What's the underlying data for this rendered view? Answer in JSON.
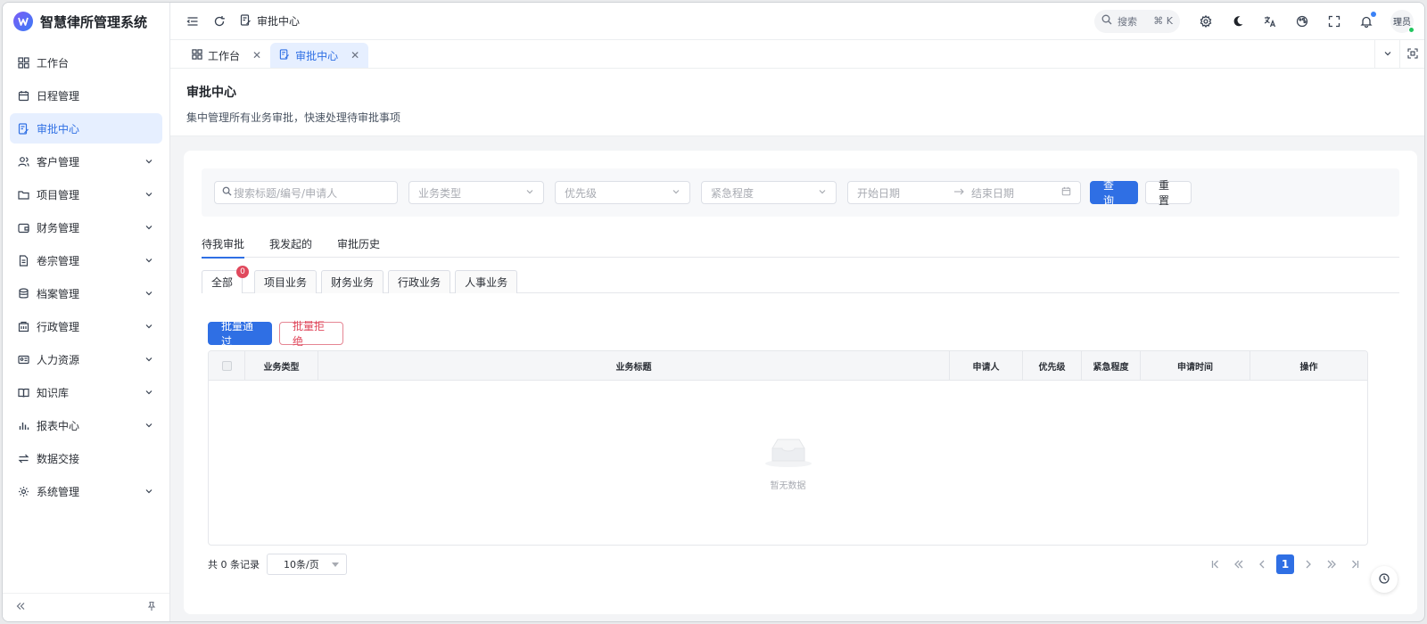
{
  "app": {
    "title": "智慧律所管理系统"
  },
  "sidebar": {
    "items": [
      {
        "label": "工作台",
        "icon": "dashboard-icon",
        "expandable": false
      },
      {
        "label": "日程管理",
        "icon": "calendar-icon",
        "expandable": false
      },
      {
        "label": "审批中心",
        "icon": "approval-icon",
        "expandable": false,
        "active": true
      },
      {
        "label": "客户管理",
        "icon": "users-icon",
        "expandable": true
      },
      {
        "label": "项目管理",
        "icon": "folder-icon",
        "expandable": true
      },
      {
        "label": "财务管理",
        "icon": "wallet-icon",
        "expandable": true
      },
      {
        "label": "卷宗管理",
        "icon": "file-icon",
        "expandable": true
      },
      {
        "label": "档案管理",
        "icon": "database-icon",
        "expandable": true
      },
      {
        "label": "行政管理",
        "icon": "building-icon",
        "expandable": true
      },
      {
        "label": "人力资源",
        "icon": "id-card-icon",
        "expandable": true
      },
      {
        "label": "知识库",
        "icon": "book-icon",
        "expandable": true
      },
      {
        "label": "报表中心",
        "icon": "bar-chart-icon",
        "expandable": true
      },
      {
        "label": "数据交接",
        "icon": "swap-icon",
        "expandable": false
      },
      {
        "label": "系统管理",
        "icon": "gear-icon",
        "expandable": true
      }
    ]
  },
  "header": {
    "breadcrumb": "审批中心",
    "search_label": "搜索",
    "shortcut": "⌘ K",
    "avatar_text": "理员"
  },
  "tabs": [
    {
      "label": "工作台",
      "icon": "dashboard-icon",
      "active": false
    },
    {
      "label": "审批中心",
      "icon": "approval-icon",
      "active": true
    }
  ],
  "page": {
    "title": "审批中心",
    "subtitle": "集中管理所有业务审批，快速处理待审批事项"
  },
  "filters": {
    "search_placeholder": "搜索标题/编号/申请人",
    "type_placeholder": "业务类型",
    "priority_placeholder": "优先级",
    "urgency_placeholder": "紧急程度",
    "start_date_placeholder": "开始日期",
    "end_date_placeholder": "结束日期",
    "query_label": "查 询",
    "reset_label": "重 置"
  },
  "main_tabs": [
    {
      "label": "待我审批",
      "active": true
    },
    {
      "label": "我发起的",
      "active": false
    },
    {
      "label": "审批历史",
      "active": false
    }
  ],
  "sub_tabs": [
    {
      "label": "全部",
      "active": true,
      "badge": "0"
    },
    {
      "label": "项目业务",
      "active": false
    },
    {
      "label": "财务业务",
      "active": false
    },
    {
      "label": "行政业务",
      "active": false
    },
    {
      "label": "人事业务",
      "active": false
    }
  ],
  "bulk": {
    "approve_label": "批量通过",
    "reject_label": "批量拒绝"
  },
  "table": {
    "columns": [
      "业务类型",
      "业务标题",
      "申请人",
      "优先级",
      "紧急程度",
      "申请时间",
      "操作"
    ],
    "rows": [],
    "empty_text": "暂无数据"
  },
  "pagination": {
    "total_text": "共 0 条记录",
    "page_size": "10条/页",
    "current_page": "1"
  },
  "colors": {
    "accent": "#2f6fe4",
    "danger": "#e0495d",
    "active_bg": "#e6efff"
  }
}
